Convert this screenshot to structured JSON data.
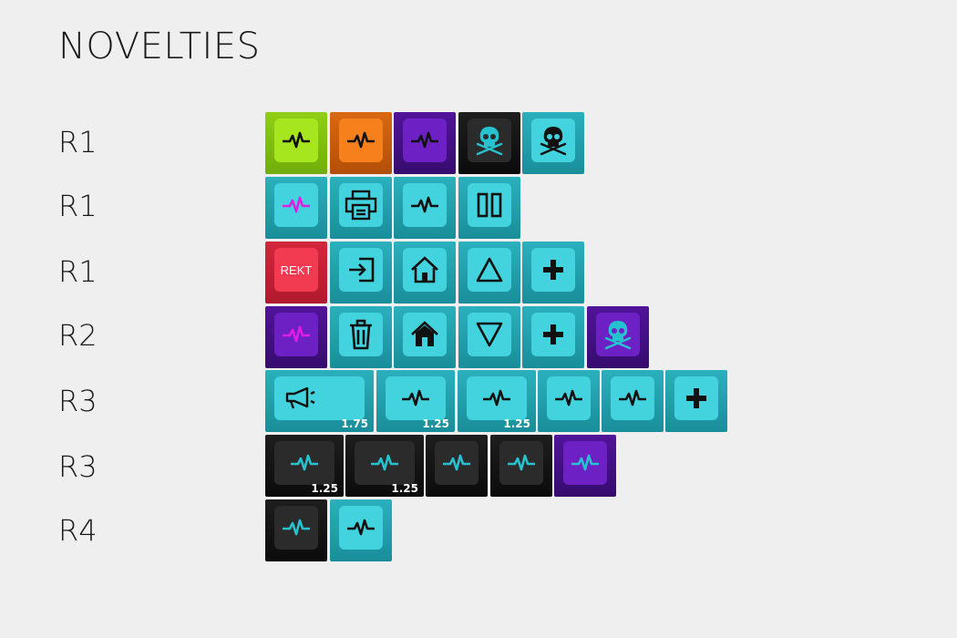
{
  "title": "NOVELTIES",
  "rows": [
    {
      "label": "R1"
    },
    {
      "label": "R1"
    },
    {
      "label": "R1"
    },
    {
      "label": "R2"
    },
    {
      "label": "R3"
    },
    {
      "label": "R3"
    },
    {
      "label": "R4"
    }
  ],
  "keys": {
    "rekt": "REKT",
    "size_175": "1.75",
    "size_125a": "1.25",
    "size_125b": "1.25",
    "size_125c": "1.25",
    "size_125d": "1.25"
  },
  "colors": {
    "lime": "#a6e61f",
    "orange": "#f6801c",
    "purple": "#6d21c4",
    "black": "#2b2b2b",
    "cyan": "#42d3df",
    "red": "#f23b51",
    "magenta_legend": "#e21ce6",
    "cyan_legend": "#27c2cf"
  },
  "icons": [
    "pulse-icon",
    "skull-crossbones-icon",
    "printer-icon",
    "pause-icon",
    "enter-icon",
    "home-icon",
    "triangle-up-icon",
    "plus-icon",
    "trash-icon",
    "triangle-down-icon",
    "megaphone-icon"
  ]
}
